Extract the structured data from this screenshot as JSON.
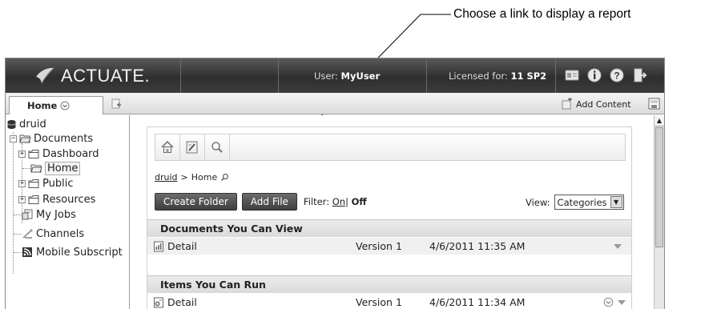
{
  "callout": {
    "text": "Choose a link to display a report"
  },
  "banner": {
    "logo_text": "ACTUATE.",
    "user_label": "User: ",
    "user_name": "MyUser",
    "license_label": "Licensed for: ",
    "license_value": "11 SP2"
  },
  "tabs": {
    "home_label": "Home",
    "add_content_label": "Add Content"
  },
  "sidebar": {
    "items": [
      {
        "label": "druid"
      },
      {
        "label": "Documents"
      },
      {
        "label": "Dashboard"
      },
      {
        "label": "Home"
      },
      {
        "label": "Public"
      },
      {
        "label": "Resources"
      },
      {
        "label": "My Jobs"
      },
      {
        "label": "Channels"
      },
      {
        "label": "Mobile Subscript"
      }
    ]
  },
  "breadcrumb": {
    "root": "druid",
    "separator": ">",
    "current": "Home"
  },
  "actions": {
    "create_folder": "Create Folder",
    "add_file": "Add File",
    "filter_label": "Filter:",
    "filter_on": "On",
    "filter_sep": "|",
    "filter_off": "Off",
    "view_label": "View:",
    "view_value": "Categories"
  },
  "sections": [
    {
      "title": "Documents You Can View",
      "rows": [
        {
          "name": "Detail",
          "version": "Version 1",
          "date": "4/6/2011 11:35 AM"
        }
      ]
    },
    {
      "title": "Items You Can Run",
      "rows": [
        {
          "name": "Detail",
          "version": "Version 1",
          "date": "4/6/2011 11:34 AM"
        }
      ]
    }
  ],
  "colors": {
    "banner": "#3a3a3a",
    "section_header": "#e0e0e0",
    "button": "#4a4a4a"
  }
}
